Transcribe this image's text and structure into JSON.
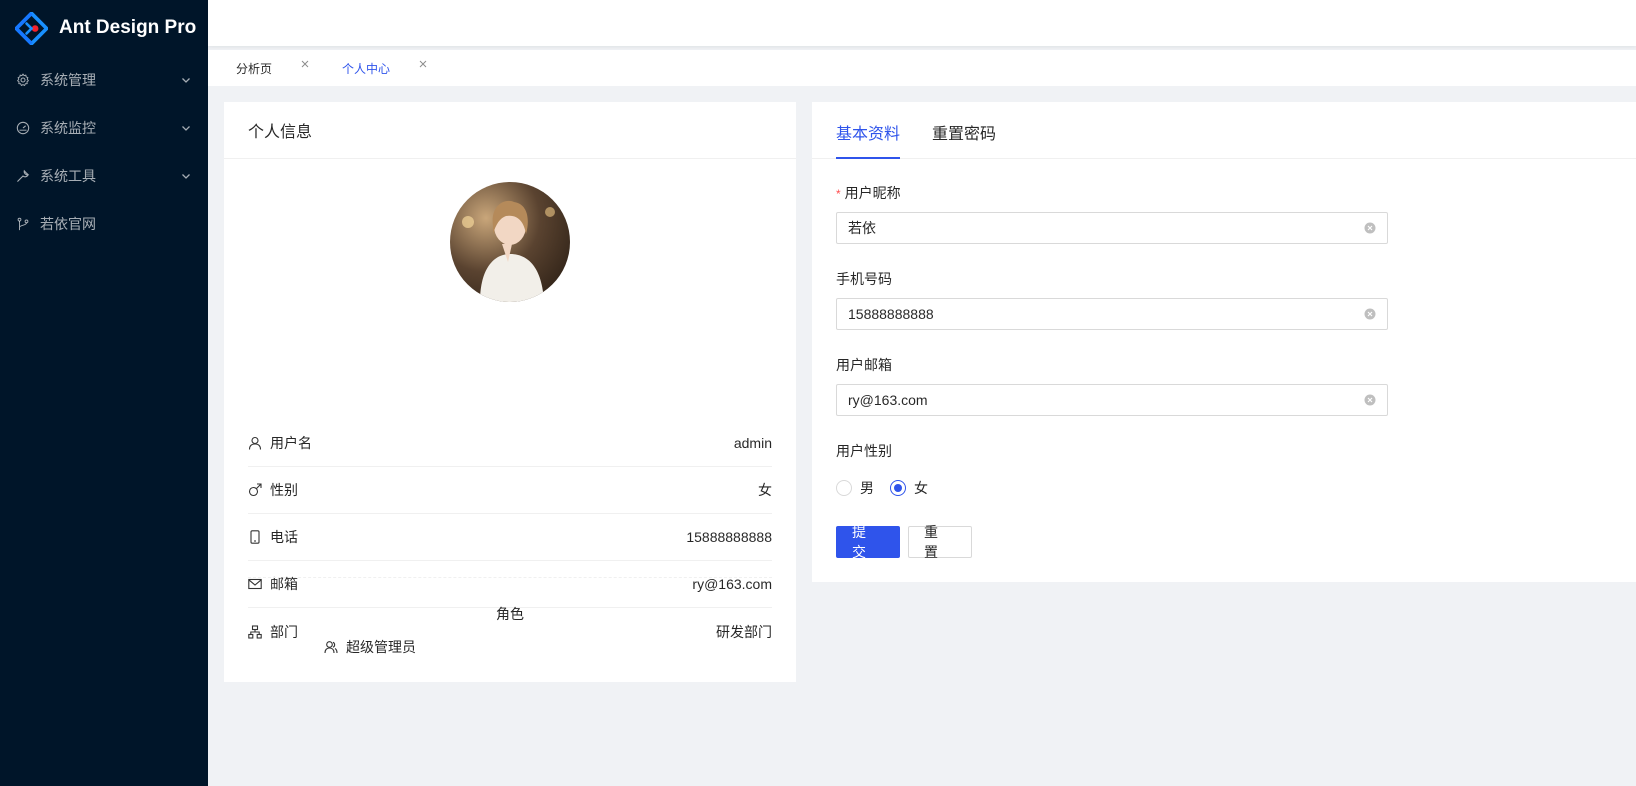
{
  "app": {
    "title": "Ant Design Pro"
  },
  "sidebar": {
    "items": [
      {
        "label": "系统管理",
        "icon": "gear-icon"
      },
      {
        "label": "系统监控",
        "icon": "dashboard-icon"
      },
      {
        "label": "系统工具",
        "icon": "tool-icon"
      },
      {
        "label": "若依官网",
        "icon": "branch-icon"
      }
    ]
  },
  "tabs": [
    {
      "label": "分析页"
    },
    {
      "label": "个人中心"
    }
  ],
  "profile_card": {
    "title": "个人信息",
    "rows": [
      {
        "label": "用户名",
        "value": "admin",
        "icon": "user-icon"
      },
      {
        "label": "性别",
        "value": "女",
        "icon": "man-icon"
      },
      {
        "label": "电话",
        "value": "15888888888",
        "icon": "mobile-icon"
      },
      {
        "label": "邮箱",
        "value": "ry@163.com",
        "icon": "mail-icon"
      },
      {
        "label": "部门",
        "value": "研发部门",
        "icon": "cluster-icon"
      }
    ],
    "roles_title": "角色",
    "role": "超级管理员"
  },
  "settings_card": {
    "tabs": [
      "基本资料",
      "重置密码"
    ],
    "form": {
      "nickname_label": "用户昵称",
      "nickname_value": "若依",
      "phone_label": "手机号码",
      "phone_value": "15888888888",
      "email_label": "用户邮箱",
      "email_value": "ry@163.com",
      "sex_label": "用户性别",
      "sex_options": [
        "男",
        "女"
      ],
      "submit_label": "提 交",
      "reset_label": "重 置"
    }
  },
  "colors": {
    "primary": "#2f54eb",
    "sider": "#001529",
    "required": "#ff4d4f"
  }
}
